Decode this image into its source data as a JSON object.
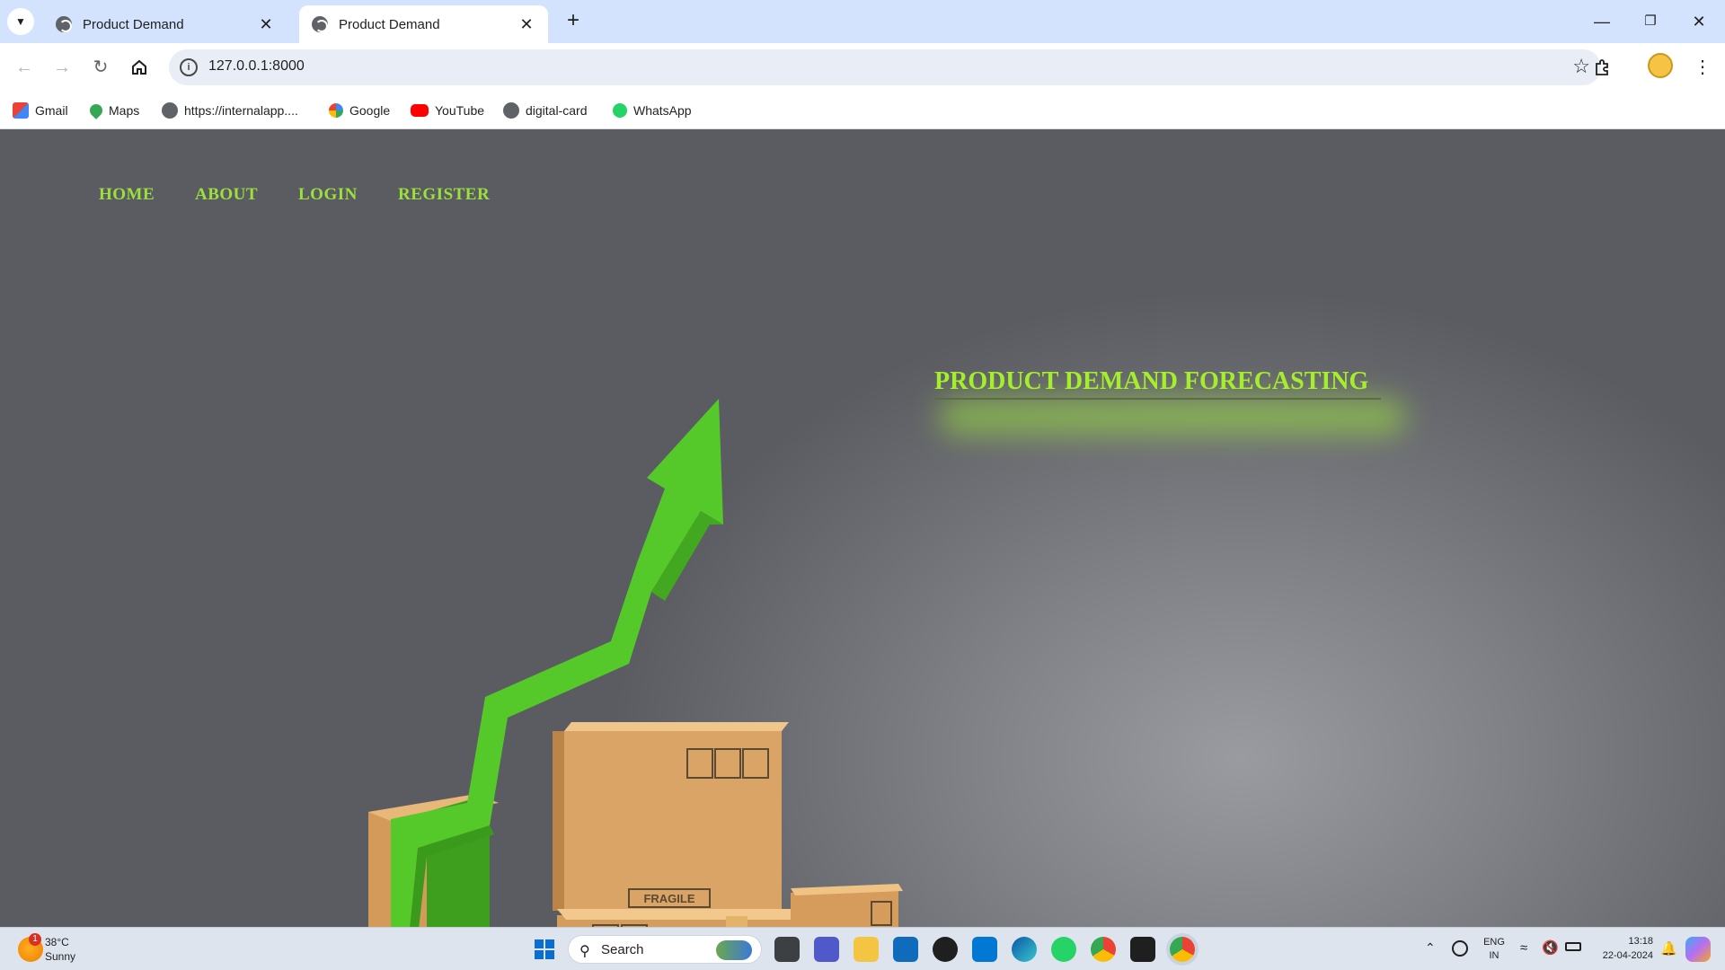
{
  "browser": {
    "tabs": [
      {
        "title": "Product Demand",
        "active": false
      },
      {
        "title": "Product Demand",
        "active": true
      }
    ],
    "new_tab_label": "+",
    "address": "127.0.0.1:8000",
    "bookmarks": [
      {
        "label": "Gmail",
        "icon": "gmail-icon"
      },
      {
        "label": "Maps",
        "icon": "maps-icon"
      },
      {
        "label": "https://internalapp....",
        "icon": "globe-icon"
      },
      {
        "label": "Google",
        "icon": "google-icon"
      },
      {
        "label": "YouTube",
        "icon": "youtube-icon"
      },
      {
        "label": "digital-card",
        "icon": "globe-icon"
      },
      {
        "label": "WhatsApp",
        "icon": "whatsapp-icon"
      }
    ]
  },
  "site": {
    "nav": [
      "HOME",
      "ABOUT",
      "LOGIN",
      "REGISTER"
    ],
    "hero_title": "PRODUCT DEMAND FORECASTING",
    "box_labels": [
      "FRAGILE"
    ],
    "accent_color": "#9be03c"
  },
  "taskbar": {
    "weather": {
      "temp": "38°C",
      "condition": "Sunny",
      "badge": "1"
    },
    "search_placeholder": "Search",
    "language": {
      "line1": "ENG",
      "line2": "IN"
    },
    "clock": {
      "time": "13:18",
      "date": "22-04-2024"
    }
  }
}
